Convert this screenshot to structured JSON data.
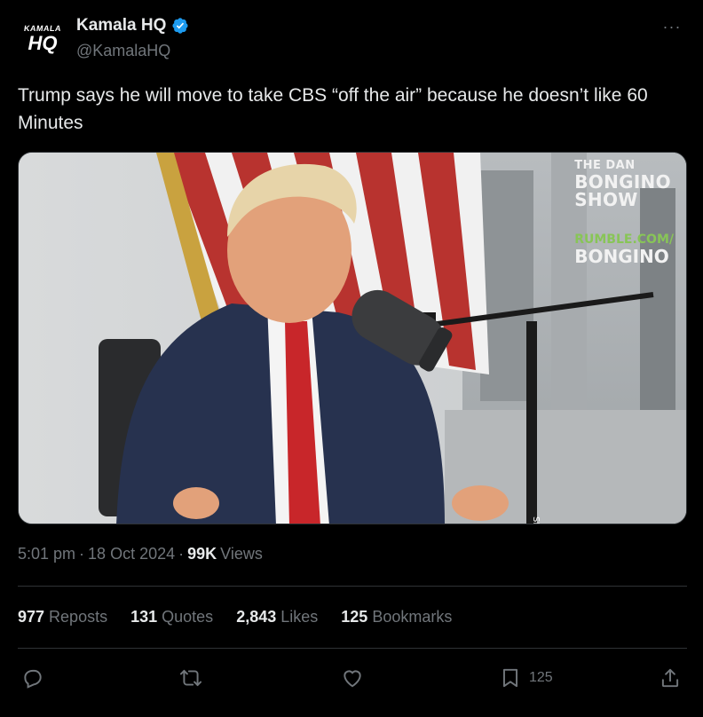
{
  "author": {
    "avatar_small": "KAMALA",
    "avatar_big": "HQ",
    "display_name": "Kamala HQ",
    "handle": "@KamalaHQ",
    "verified_icon": "verified-badge-icon",
    "verified_color": "#1d9bf0"
  },
  "more_label": "···",
  "tweet": {
    "text": "Trump says he will move to take CBS “off the air” because he doesn’t like 60 Minutes"
  },
  "media": {
    "watermark_line1": "THE DAN",
    "watermark_line2": "BONGINO",
    "watermark_line3": "SHOW",
    "watermark_line4": "RUMBLE.COM/",
    "watermark_line5": "BONGINO",
    "mic_brand": "SHURE"
  },
  "meta": {
    "time": "5:01 pm",
    "sep1": "·",
    "date": "18 Oct 2024",
    "sep2": "·",
    "views_count": "99K",
    "views_label": "Views"
  },
  "stats": [
    {
      "count": "977",
      "label": "Reposts"
    },
    {
      "count": "131",
      "label": "Quotes"
    },
    {
      "count": "2,843",
      "label": "Likes"
    },
    {
      "count": "125",
      "label": "Bookmarks"
    }
  ],
  "actions": {
    "reply_icon": "reply-icon",
    "repost_icon": "repost-icon",
    "like_icon": "heart-icon",
    "bookmark_icon": "bookmark-icon",
    "bookmark_count": "125",
    "share_icon": "share-icon"
  },
  "colors": {
    "background": "#000000",
    "text_primary": "#e7e9ea",
    "text_secondary": "#71767b",
    "divider": "#2f3336",
    "accent": "#1d9bf0"
  }
}
